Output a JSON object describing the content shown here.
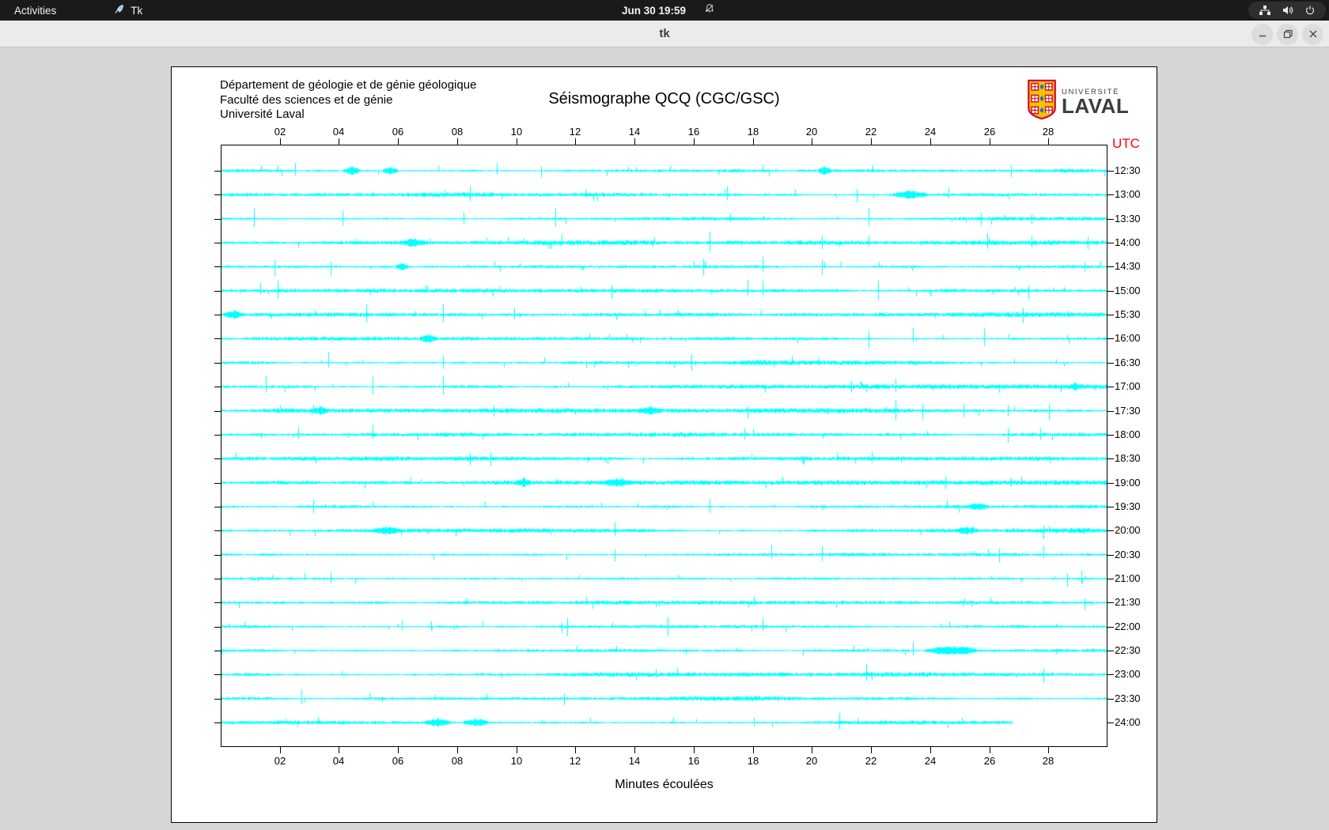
{
  "top_bar": {
    "activities_label": "Activities",
    "app_menu_label": "Tk",
    "clock": "Jun 30 19:59"
  },
  "titlebar": {
    "title": "tk"
  },
  "document": {
    "institution_lines": [
      "Département de géologie et de génie géologique",
      "Faculté des sciences et de génie",
      "Université Laval"
    ],
    "title": "Séismographe QCQ (CGC/GSC)",
    "logo": {
      "top": "UNIVERSITÉ",
      "bottom": "LAVAL"
    }
  },
  "chart": {
    "type": "seismogram",
    "utc_label": "UTC",
    "x_axis_label": "Minutes écoulées",
    "x_tick_labels": [
      "02",
      "04",
      "06",
      "08",
      "10",
      "12",
      "14",
      "16",
      "18",
      "20",
      "22",
      "24",
      "26",
      "28"
    ],
    "x_range_minutes": [
      0,
      30
    ],
    "colors": {
      "trace": "#00ffff",
      "utc_label": "#ff0000",
      "axis": "#000000"
    },
    "traces": [
      {
        "utc": "12:30",
        "spikes": [
          2.5,
          9.3,
          10.8,
          26.7
        ],
        "bursts": [
          4.4,
          5.7,
          20.4
        ]
      },
      {
        "utc": "13:00",
        "spikes": [
          8.4,
          17.1,
          21.5,
          24.6
        ],
        "bursts": [
          23.3
        ]
      },
      {
        "utc": "13:30",
        "spikes": [
          1.1,
          4.1,
          8.2,
          11.3,
          17.2,
          21.9,
          25.7,
          27.4
        ],
        "bursts": []
      },
      {
        "utc": "14:00",
        "spikes": [
          11.5,
          16.5,
          20.3,
          21.9,
          25.9,
          27.4,
          29.3
        ],
        "bursts": [
          6.5
        ]
      },
      {
        "utc": "14:30",
        "spikes": [
          1.8,
          3.7,
          16.3,
          18.3,
          20.3,
          29.2
        ],
        "bursts": [
          6.1
        ]
      },
      {
        "utc": "15:00",
        "spikes": [
          1.3,
          1.9,
          13.2,
          17.8,
          18.3,
          22.2,
          27.3
        ],
        "bursts": []
      },
      {
        "utc": "15:30",
        "spikes": [
          4.9,
          7.5,
          9.9,
          27.1
        ],
        "bursts": [
          0.4
        ]
      },
      {
        "utc": "16:00",
        "spikes": [
          21.9,
          23.4,
          25.8
        ],
        "bursts": [
          7.0
        ]
      },
      {
        "utc": "16:30",
        "spikes": [
          3.6,
          7.5,
          15.9
        ],
        "bursts": []
      },
      {
        "utc": "17:00",
        "spikes": [
          1.5,
          5.1,
          7.5,
          21.3,
          22.8
        ],
        "bursts": [
          28.9
        ]
      },
      {
        "utc": "17:30",
        "spikes": [
          9.2,
          17.8,
          22.8,
          23.7,
          25.1,
          26.6,
          28.0
        ],
        "bursts": [
          3.3,
          14.5
        ]
      },
      {
        "utc": "18:00",
        "spikes": [
          2.6,
          5.1,
          17.7,
          26.6,
          27.7
        ],
        "bursts": []
      },
      {
        "utc": "18:30",
        "spikes": [
          8.4,
          9.1,
          22.0
        ],
        "bursts": []
      },
      {
        "utc": "19:00",
        "spikes": [
          24.5,
          26.7
        ],
        "bursts": [
          10.2,
          13.4
        ]
      },
      {
        "utc": "19:30",
        "spikes": [
          3.1,
          16.5
        ],
        "bursts": [
          25.6
        ]
      },
      {
        "utc": "20:00",
        "spikes": [
          13.3,
          27.8
        ],
        "bursts": [
          5.6,
          25.2
        ]
      },
      {
        "utc": "20:30",
        "spikes": [
          13.3,
          18.6,
          20.3,
          26.3,
          27.8
        ],
        "bursts": []
      },
      {
        "utc": "21:00",
        "spikes": [
          3.7,
          28.6,
          29.1
        ],
        "bursts": []
      },
      {
        "utc": "21:30",
        "spikes": [
          18.0,
          29.2
        ],
        "bursts": []
      },
      {
        "utc": "22:00",
        "spikes": [
          6.1,
          7.1,
          11.5,
          11.7,
          15.1,
          18.3
        ],
        "bursts": []
      },
      {
        "utc": "22:30",
        "spikes": [
          23.4
        ],
        "bursts": [
          24.4,
          24.55,
          24.7,
          25.0,
          25.1,
          25.25
        ]
      },
      {
        "utc": "23:00",
        "spikes": [
          14.7,
          21.8,
          27.8
        ],
        "bursts": []
      },
      {
        "utc": "23:30",
        "spikes": [
          2.7,
          11.6
        ],
        "bursts": []
      },
      {
        "utc": "24:00",
        "spikes": [
          18.0,
          20.9
        ],
        "bursts": [
          7.3,
          8.6
        ],
        "end_minute": 26.8
      }
    ]
  }
}
